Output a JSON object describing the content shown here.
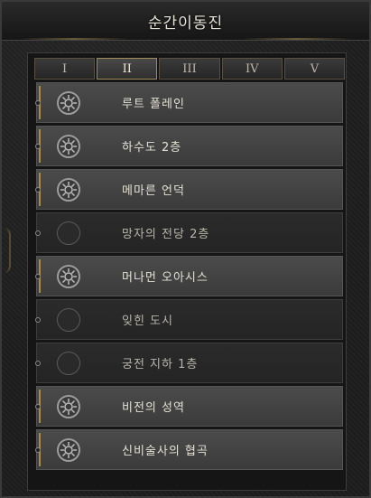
{
  "window": {
    "title": "순간이동진"
  },
  "tabs": [
    {
      "label": "I",
      "active": false
    },
    {
      "label": "II",
      "active": true
    },
    {
      "label": "III",
      "active": false
    },
    {
      "label": "IV",
      "active": false
    },
    {
      "label": "V",
      "active": false
    }
  ],
  "locations": [
    {
      "name": "루트 폴레인",
      "icon": "gear",
      "available": true
    },
    {
      "name": "하수도 2층",
      "icon": "gear",
      "available": true
    },
    {
      "name": "메마른 언덕",
      "icon": "gear",
      "available": true
    },
    {
      "name": "망자의 전당 2층",
      "icon": "empty",
      "available": false
    },
    {
      "name": "머나먼 오아시스",
      "icon": "gear",
      "available": true
    },
    {
      "name": "잊힌 도시",
      "icon": "empty",
      "available": false
    },
    {
      "name": "궁전 지하 1층",
      "icon": "empty",
      "available": false
    },
    {
      "name": "비전의 성역",
      "icon": "gear",
      "available": true
    },
    {
      "name": "신비술사의 협곡",
      "icon": "gear",
      "available": true
    }
  ]
}
